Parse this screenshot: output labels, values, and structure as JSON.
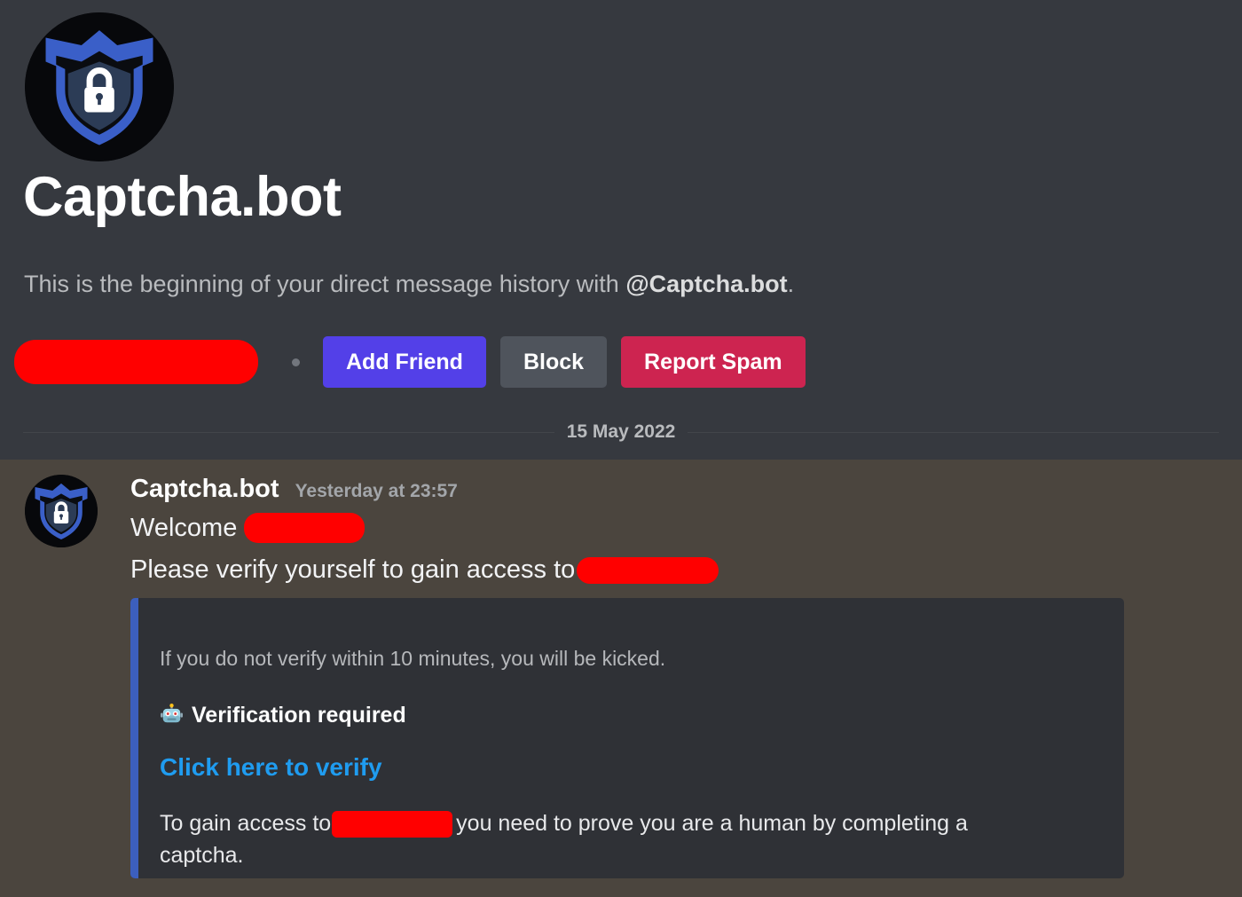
{
  "dm_intro": {
    "avatar_icon": "shield-lock-icon",
    "title": "Captcha.bot",
    "subtitle_prefix": "This is the beginning of your direct message history with ",
    "subtitle_mention": "@Captcha.bot",
    "subtitle_suffix": ".",
    "mutual_redacted": true,
    "buttons": [
      {
        "label": "Add Friend",
        "name": "add-friend-button",
        "color": "#5340e8"
      },
      {
        "label": "Block",
        "name": "block-button",
        "color": "#4f545c"
      },
      {
        "label": "Report Spam",
        "name": "report-spam-button",
        "color": "#cd2450"
      }
    ]
  },
  "date_divider": {
    "label": "15 May 2022"
  },
  "message": {
    "avatar_icon": "shield-lock-icon",
    "author": "Captcha.bot",
    "timestamp": "Yesterday at 23:57",
    "line_1_prefix": "Welcome",
    "line_1_redacted": true,
    "line_2_prefix": "Please verify yourself to gain access to",
    "line_2_redacted": true
  },
  "embed": {
    "accent_color": "#3c5fbd",
    "background_color": "#2f3136",
    "description": "If you do not verify within 10 minutes, you will be kicked.",
    "field_emoji": "robot-face-emoji",
    "field_name": "Verification required",
    "link_label": "Click here to verify",
    "link_color": "#1f9cf0",
    "field_value_prefix": "To gain access to",
    "field_value_redacted": true,
    "field_value_suffix": "you need to prove you are a human by completing a captcha."
  },
  "colors": {
    "page_background": "#36393f",
    "message_hover_background": "#4b453e",
    "redaction": "#ff0000",
    "text_primary": "#f2f3f5",
    "text_muted": "#b9bbbe"
  }
}
